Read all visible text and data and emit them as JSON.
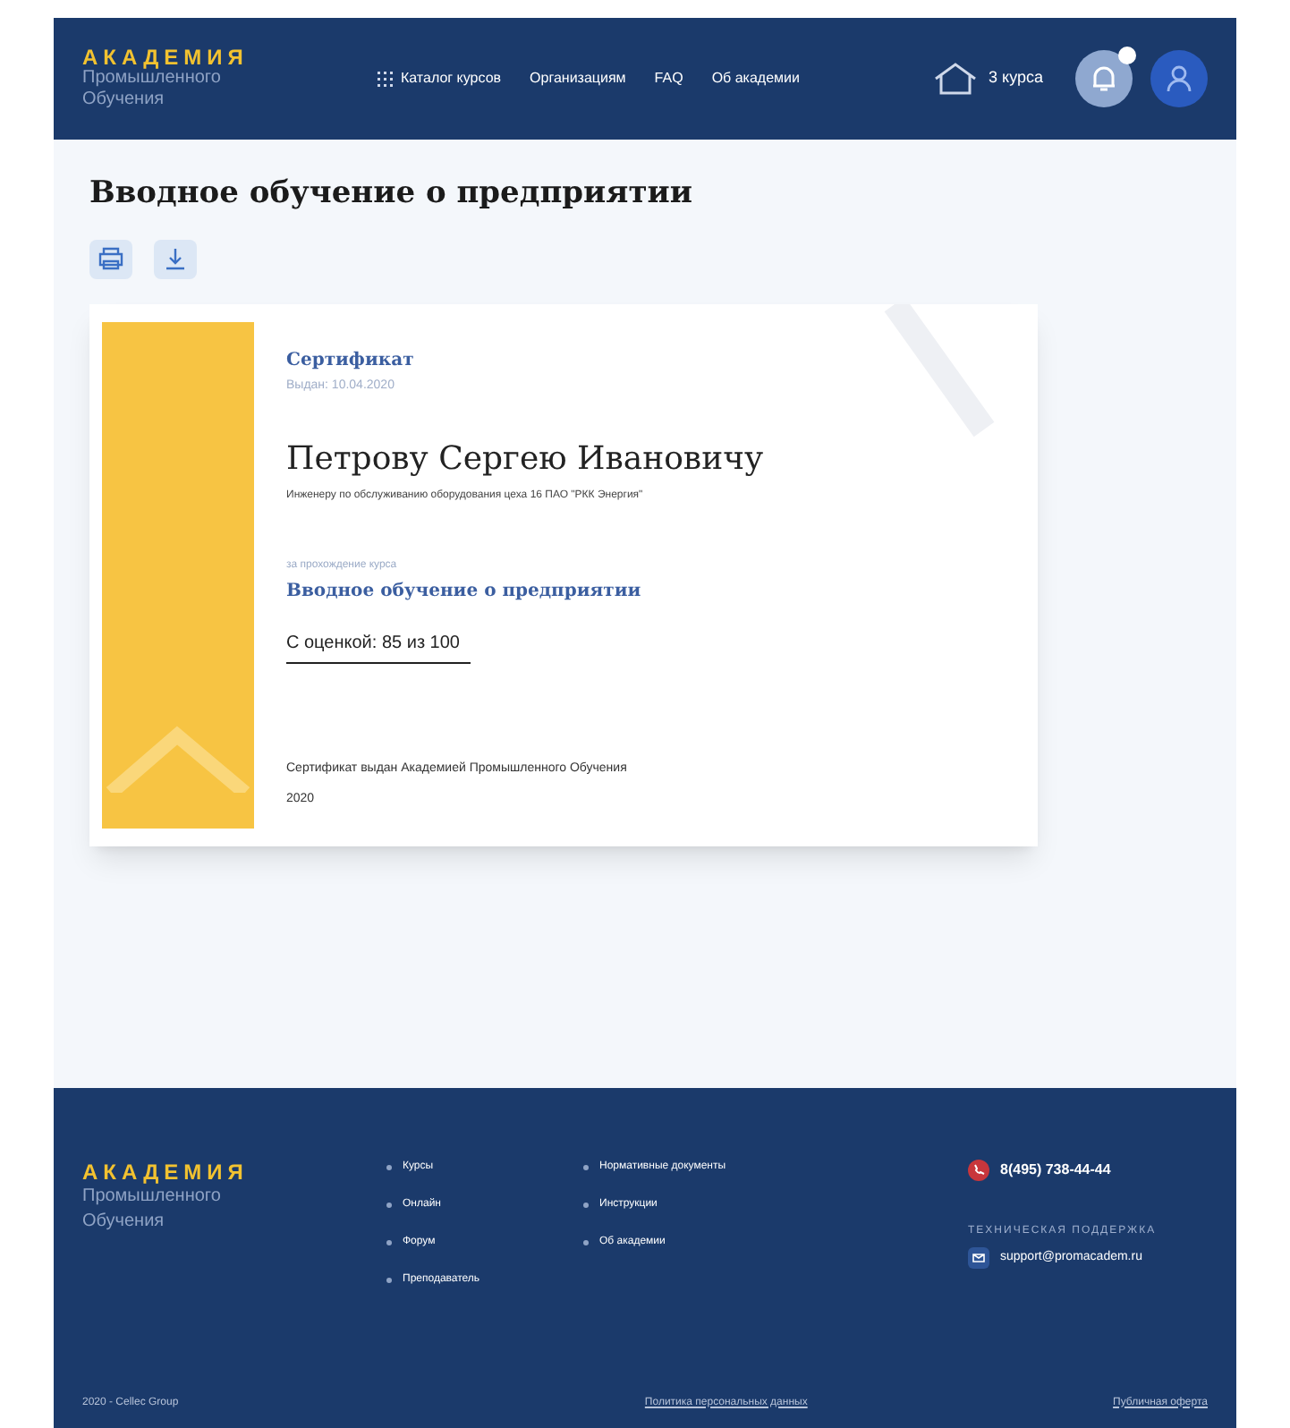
{
  "header": {
    "logo": {
      "title": "АКАДЕМИЯ",
      "line_1": "Промышленного",
      "line_2": "Обучения"
    },
    "nav": [
      {
        "label": "Каталог курсов",
        "kind": "catalog"
      },
      {
        "label": "Организациям",
        "kind": "link"
      },
      {
        "label": "FAQ",
        "kind": "link"
      },
      {
        "label": "Об академии",
        "kind": "link"
      }
    ],
    "courses": "3 курса",
    "notifications_badge": true
  },
  "page_title": "Вводное обучение о предприятии",
  "certificate": {
    "heading": "Сертификат",
    "issued": "Выдан: 10.04.2020",
    "recipient": "Петрову Сергею Ивановичу",
    "position": "Инженеру по обслуживанию оборудования цеха 16 ПАО \"РКК Энергия\"",
    "course_caption": "за прохождение курса",
    "course": "Вводное обучение о предприятии",
    "grade": "С оценкой: 85 из 100",
    "issuer": "Сертификат выдан Академией Промышленного Обучения",
    "year": "2020"
  },
  "footer": {
    "logo": {
      "title": "АКАДЕМИЯ",
      "line_1": "Промышленного",
      "line_2": "Обучения"
    },
    "links_1": [
      "Курсы",
      "Онлайн",
      "Форум",
      "Преподаватель"
    ],
    "links_2": [
      "Нормативные документы",
      "Инструкции",
      "Об академии"
    ],
    "phone": "8(495) 738-44-44",
    "support_label": "ТЕХНИЧЕСКАЯ ПОДДЕРЖКА",
    "email": "support@promacadem.ru",
    "copyright": "2020 - Cellec Group",
    "privacy": "Политика персональных данных",
    "offer": "Публичная оферта"
  }
}
